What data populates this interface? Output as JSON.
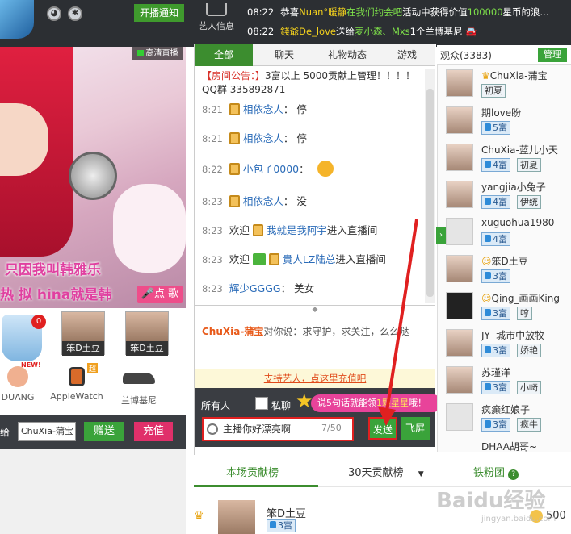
{
  "topbar": {
    "notify_button": "开播通知",
    "artist_info": "艺人信息",
    "ticker1": {
      "time": "08:22",
      "pre": "恭喜",
      "name": "Nuan°暖静",
      "mid": "在我们约会吧",
      "post": "活动中获得价值",
      "value": "100000",
      "tail": "星币的浪..."
    },
    "ticker2": {
      "time": "08:22",
      "name": "錢爺De_love",
      "mid": "送给",
      "target": "麦小森、Mxs",
      "post": "1个兰博基尼"
    }
  },
  "video": {
    "hd_badge": "高清直播",
    "caption1": "只因我叫韩雅乐",
    "caption2": "热  拟  hina就是韩",
    "song_button": "点 歌"
  },
  "gifts": {
    "bottle_count": "0",
    "items": [
      {
        "label": "DUANG",
        "badge": "NEW!"
      },
      {
        "label": "AppleWatch",
        "badge": "超"
      },
      {
        "label": "兰博基尼"
      }
    ],
    "cards": [
      "笨D土豆",
      "笨D土豆"
    ],
    "give_label": "给",
    "give_value": "ChuXia-蒲宝",
    "give_button": "赠送",
    "charge_button": "充值"
  },
  "chat": {
    "tabs": [
      "全部",
      "聊天",
      "礼物动态",
      "游戏"
    ],
    "announcement_tag": "【房间公告：】",
    "announcement_text": "3富以上 5000贡献上管理！！！！QQ群  335892871",
    "messages": [
      {
        "time": "8:21",
        "name": "相依念人",
        "text": "停"
      },
      {
        "time": "8:21",
        "name": "相依念人",
        "text": "停"
      },
      {
        "time": "8:22",
        "name": "小包子0000",
        "text": ""
      },
      {
        "time": "8:23",
        "name": "相依念人",
        "text": "没"
      },
      {
        "time": "8:23",
        "pre": "欢迎",
        "name": "我就是我阿宇",
        "text": "进入直播间"
      },
      {
        "time": "8:23",
        "pre": "欢迎",
        "name": "貴人LZ陆总",
        "text": "进入直播间"
      },
      {
        "time": "8:23",
        "name": "辉少GGGG",
        "text": "美女"
      }
    ],
    "whisper_name": "ChuXia-蒲宝",
    "whisper_text": "对你说：求守护，求关注，么么哒",
    "support_bar": "支持艺人，点这里充值吧",
    "all_people": "所有人",
    "private_label": "私聊",
    "tip_pre": "说5句话就能领",
    "tip_hl": "1颗星星",
    "tip_post": "哦！",
    "input_value": "主播你好漂亮啊",
    "counter": "7/50",
    "send_button": "发送",
    "fly_button": "飞屏"
  },
  "audience": {
    "title": "观众(3383)",
    "admin_button": "管理",
    "users": [
      {
        "name": "ChuXia-蒲宝",
        "level": "",
        "tag": "初夏"
      },
      {
        "name": "期love盼",
        "level": "5富",
        "tag": ""
      },
      {
        "name": "ChuXia-蓝儿小天",
        "level": "4富",
        "tag": "初夏"
      },
      {
        "name": "yangjia小兔子",
        "level": "4富",
        "tag": "伊统"
      },
      {
        "name": "xuguohua1980",
        "level": "4富",
        "tag": ""
      },
      {
        "name": "笨D土豆",
        "level": "3富",
        "tag": ""
      },
      {
        "name": "Qing_画画King",
        "level": "3富",
        "tag": "哼"
      },
      {
        "name": "JY--城市中放牧",
        "level": "3富",
        "tag": "娇艳"
      },
      {
        "name": "苏瑾洋",
        "level": "3富",
        "tag": "小崎"
      },
      {
        "name": "疯癫红娘子",
        "level": "3富",
        "tag": "疯牛"
      },
      {
        "name": "DHAA胡哥~",
        "level": "",
        "tag": ""
      }
    ]
  },
  "bottom": {
    "tab1": "本场贡献榜",
    "tab2": "30天贡献榜",
    "tab3": "铁粉团",
    "rank_name": "笨D土豆",
    "rank_level": "3富",
    "rank_value": "500"
  },
  "watermark": {
    "main": "Baidu经验",
    "sub": "jingyan.baidu.com"
  },
  "colors": {
    "accent_green": "#3c8d2f",
    "highlight_red": "#e02020",
    "pink": "#e8439a"
  }
}
